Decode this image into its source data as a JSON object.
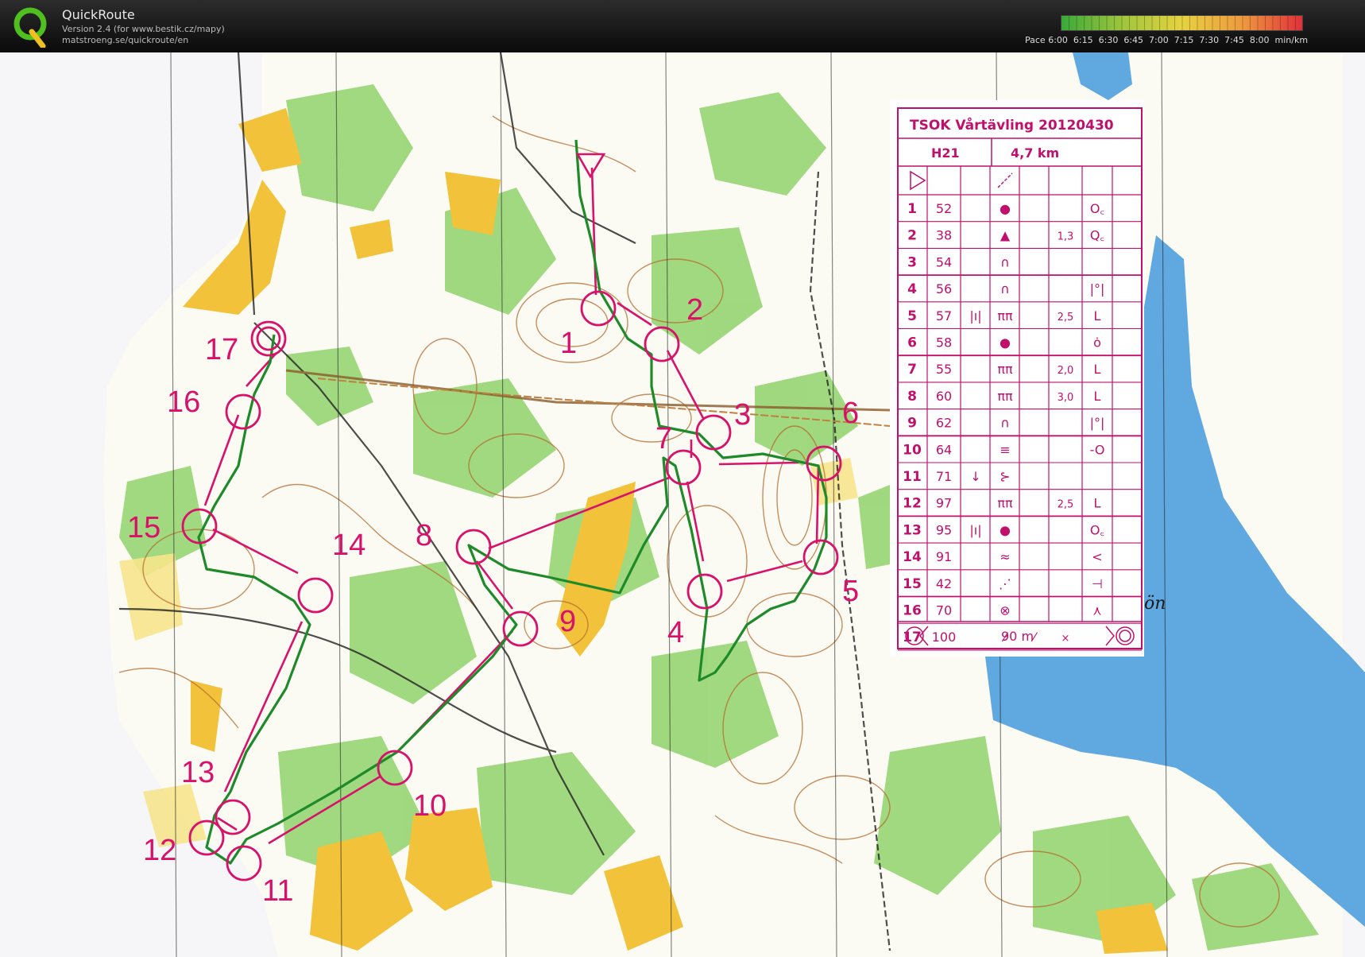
{
  "app": {
    "title": "QuickRoute",
    "version_line": "Version 2.4  (for www.bestik.cz/mapy)",
    "url_line": "matstroeng.se/quickroute/en"
  },
  "pace_legend": {
    "labels": [
      "Pace 6:00",
      "6:15",
      "6:30",
      "6:45",
      "7:00",
      "7:15",
      "7:30",
      "7:45",
      "8:00",
      "min/km"
    ],
    "colors": [
      "#3aa93a",
      "#6ab43a",
      "#a5c53c",
      "#d6d040",
      "#f0d040",
      "#f0b040",
      "#ee8b3f",
      "#e85d3c",
      "#e0303a"
    ]
  },
  "map": {
    "water_color": "#5fa8e0",
    "forest_green": "#8fd26a",
    "open_yellow": "#f2c23a",
    "course_color": "#d8126a",
    "route_color": "#1f8a2a",
    "controls": [
      "1",
      "2",
      "3",
      "4",
      "5",
      "6",
      "7",
      "8",
      "9",
      "10",
      "11",
      "12",
      "13",
      "14",
      "15",
      "16",
      "17"
    ],
    "lake_label": "ön"
  },
  "description_sheet": {
    "title": "TSOK Vårtävling 20120430",
    "class": "H21",
    "length": "4,7 km",
    "rows": [
      {
        "num": "1",
        "code": "52",
        "c": "",
        "d": "●",
        "e": "",
        "f": "",
        "g": "O꜀"
      },
      {
        "num": "2",
        "code": "38",
        "c": "",
        "d": "▲",
        "e": "",
        "f": "1,3",
        "g": "Q꜀"
      },
      {
        "num": "3",
        "code": "54",
        "c": "",
        "d": "∩",
        "e": "",
        "f": "",
        "g": ""
      },
      {
        "num": "4",
        "code": "56",
        "c": "",
        "d": "∩",
        "e": "",
        "f": "",
        "g": "|°|"
      },
      {
        "num": "5",
        "code": "57",
        "c": "|ı|",
        "d": "ππ",
        "e": "",
        "f": "2,5",
        "g": "L"
      },
      {
        "num": "6",
        "code": "58",
        "c": "",
        "d": "●",
        "e": "",
        "f": "",
        "g": "ȯ"
      },
      {
        "num": "7",
        "code": "55",
        "c": "",
        "d": "ππ",
        "e": "",
        "f": "2,0",
        "g": "L"
      },
      {
        "num": "8",
        "code": "60",
        "c": "",
        "d": "ππ",
        "e": "",
        "f": "3,0",
        "g": "L"
      },
      {
        "num": "9",
        "code": "62",
        "c": "",
        "d": "∩",
        "e": "",
        "f": "",
        "g": "|°|"
      },
      {
        "num": "10",
        "code": "64",
        "c": "",
        "d": "≡",
        "e": "",
        "f": "",
        "g": "-O"
      },
      {
        "num": "11",
        "code": "71",
        "c": "↓",
        "d": "⊱",
        "e": "",
        "f": "",
        "g": ""
      },
      {
        "num": "12",
        "code": "97",
        "c": "",
        "d": "ππ",
        "e": "",
        "f": "2,5",
        "g": "L"
      },
      {
        "num": "13",
        "code": "95",
        "c": "|ı|",
        "d": "●",
        "e": "",
        "f": "",
        "g": "O꜀"
      },
      {
        "num": "14",
        "code": "91",
        "c": "",
        "d": "≈",
        "e": "",
        "f": "",
        "g": "<"
      },
      {
        "num": "15",
        "code": "42",
        "c": "",
        "d": "⋰",
        "e": "",
        "f": "",
        "g": "⊣"
      },
      {
        "num": "16",
        "code": "70",
        "c": "",
        "d": "⊗",
        "e": "",
        "f": "",
        "g": "⋏"
      },
      {
        "num": "17",
        "code": "100",
        "c": "",
        "d": "⁄",
        "e": "⁄",
        "f": "×",
        "g": ""
      }
    ],
    "footer_distance": "90 m"
  }
}
